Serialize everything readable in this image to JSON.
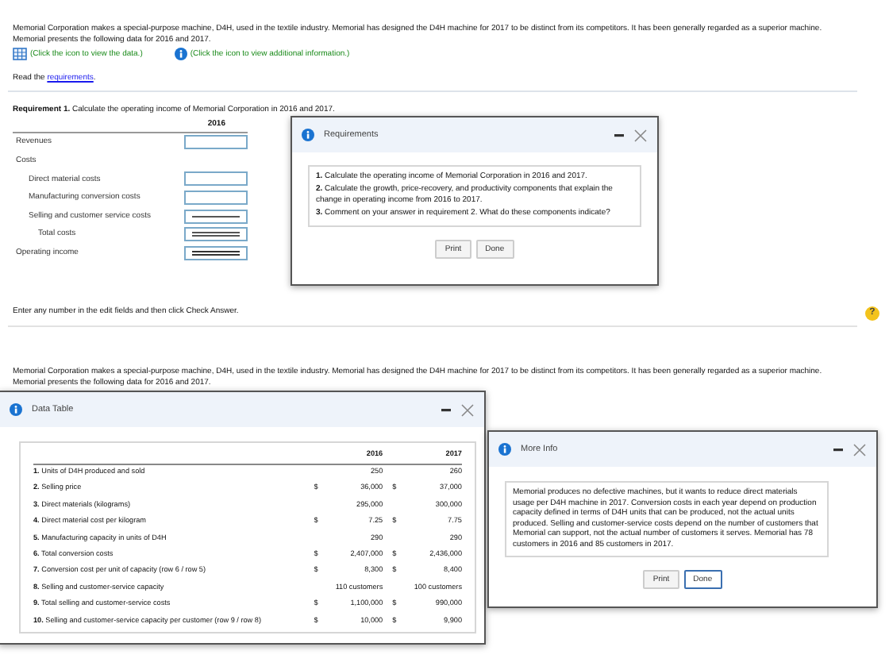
{
  "top": {
    "intro": "Memorial Corporation makes a special-purpose machine, D4H, used in the textile industry. Memorial has designed the D4H machine for 2017 to be distinct from its competitors. It has been generally regarded as a superior machine. Memorial presents the following data for 2016 and 2017.",
    "data_link": "(Click the icon to view the data.)",
    "info_link": "(Click the icon to view additional information.)",
    "read": {
      "before": "Read the ",
      "link": "requirements",
      "after": "."
    },
    "requirement": "**Requirement 1.** Calculate the operating income of Memorial Corporation in 2016 and 2017.",
    "answer_table": {
      "column": "2016",
      "rows": [
        {
          "label": "Revenues",
          "kind": "line"
        },
        {
          "label": "Costs",
          "kind": "group"
        },
        {
          "label": "Direct material costs",
          "kind": "item"
        },
        {
          "label": "Manufacturing conversion costs",
          "kind": "item"
        },
        {
          "label": "Selling and customer service costs",
          "kind": "item_ruled"
        },
        {
          "label": "Total costs",
          "kind": "subtotal"
        },
        {
          "label": "Operating income",
          "kind": "total"
        }
      ]
    },
    "requirements_dialog": {
      "title": "Requirements",
      "items": [
        "**1.** Calculate the operating income of Memorial Corporation in 2016 and 2017.",
        "**2.** Calculate the growth, price-recovery, and productivity components that explain the change in operating income from 2016 to 2017.",
        "**3.** Comment on your answer in requirement 2. What do these components indicate?"
      ],
      "buttons": [
        {
          "label": "Print",
          "focused": false
        },
        {
          "label": "Done",
          "focused": false
        }
      ]
    },
    "instruction": "Enter any number in the edit fields and then click Check Answer.",
    "help": "?"
  },
  "bottom": {
    "intro": "Memorial Corporation makes a special-purpose machine, D4H, used in the textile industry. Memorial has designed the D4H machine for 2017 to be distinct from its competitors. It has been generally regarded as a superior machine. Memorial presents the following data for 2016 and 2017.",
    "data_dialog": {
      "title": "Data Table",
      "columns": [
        "2016",
        "2017"
      ],
      "rows": [
        {
          "label": "**1.** Units of D4H produced and sold",
          "values": [
            {
              "amount": "250"
            },
            {
              "amount": "260"
            }
          ]
        },
        {
          "label": "**2.** Selling price",
          "values": [
            {
              "currency": "$",
              "amount": "36,000"
            },
            {
              "currency": "$",
              "amount": "37,000"
            }
          ]
        },
        {
          "label": "**3.** Direct materials (kilograms)",
          "values": [
            {
              "amount": "295,000"
            },
            {
              "amount": "300,000"
            }
          ]
        },
        {
          "label": "**4.** Direct material cost per kilogram",
          "values": [
            {
              "currency": "$",
              "amount": "7.25"
            },
            {
              "currency": "$",
              "amount": "7.75"
            }
          ]
        },
        {
          "label": "**5.** Manufacturing capacity in units of D4H",
          "values": [
            {
              "amount": "290"
            },
            {
              "amount": "290"
            }
          ]
        },
        {
          "label": "**6.** Total conversion costs",
          "values": [
            {
              "currency": "$",
              "amount": "2,407,000"
            },
            {
              "currency": "$",
              "amount": "2,436,000"
            }
          ]
        },
        {
          "label": "**7.** Conversion cost per unit of capacity (row 6 / row 5)",
          "values": [
            {
              "currency": "$",
              "amount": "8,300"
            },
            {
              "currency": "$",
              "amount": "8,400"
            }
          ]
        },
        {
          "label": "**8.** Selling and customer-service capacity",
          "values": [
            {
              "amount": "110 customers"
            },
            {
              "amount": "100 customers"
            }
          ]
        },
        {
          "label": "**9.** Total selling and customer-service costs",
          "values": [
            {
              "currency": "$",
              "amount": "1,100,000"
            },
            {
              "currency": "$",
              "amount": "990,000"
            }
          ]
        },
        {
          "label": "**10.** Selling and customer-service capacity per customer (row 9 / row 8)",
          "values": [
            {
              "currency": "$",
              "amount": "10,000"
            },
            {
              "currency": "$",
              "amount": "9,900"
            }
          ]
        }
      ]
    },
    "info_dialog": {
      "title": "More Info",
      "text": "Memorial produces no defective machines, but it wants to reduce direct materials usage per D4H machine in 2017. Conversion costs in each year depend on production capacity defined in terms of D4H units that can be produced, not the actual units produced. Selling and customer-service costs depend on the number of customers that Memorial can support, not the actual number of customers it serves. Memorial has 78 customers in 2016 and 85 customers in 2017.",
      "buttons": [
        {
          "label": "Print",
          "focused": false
        },
        {
          "label": "Done",
          "focused": true
        }
      ]
    }
  }
}
